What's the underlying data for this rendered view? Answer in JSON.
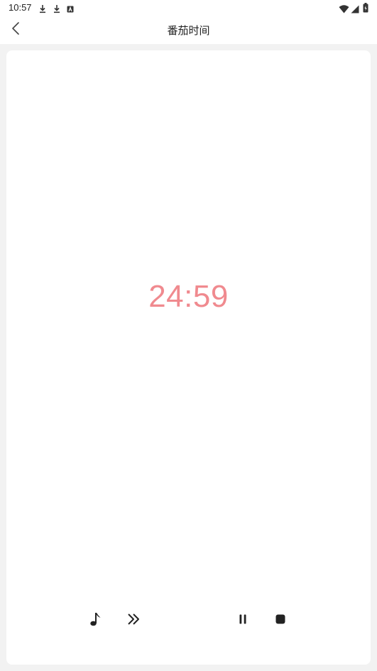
{
  "status_bar": {
    "time": "10:57",
    "icons": [
      "download-icon",
      "download-icon",
      "accessibility-icon",
      "wifi-icon",
      "signal-icon",
      "battery-icon"
    ]
  },
  "header": {
    "title": "番茄时间",
    "back_icon": "chevron-left-icon"
  },
  "timer": {
    "remaining": "24:59",
    "color": "#f08a8f"
  },
  "controls": [
    {
      "name": "music-button",
      "icon": "music-note-icon"
    },
    {
      "name": "skip-button",
      "icon": "double-chevron-icon"
    },
    {
      "name": "pause-button",
      "icon": "pause-icon"
    },
    {
      "name": "stop-button",
      "icon": "stop-icon"
    }
  ]
}
